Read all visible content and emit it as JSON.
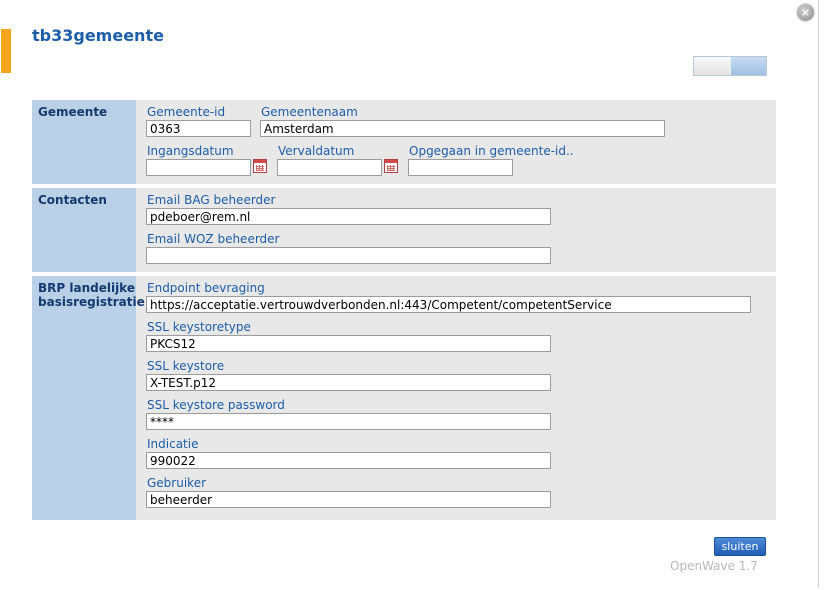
{
  "dialog": {
    "title": "tb33gemeente",
    "close_glyph": "×",
    "footer": "OpenWave 1.7",
    "close_button_label": "sluiten"
  },
  "sections": {
    "gemeente": {
      "heading": "Gemeente",
      "gemeente_id": {
        "label": "Gemeente-id",
        "value": "0363"
      },
      "gemeentenaam": {
        "label": "Gemeentenaam",
        "value": "Amsterdam"
      },
      "ingangsdatum": {
        "label": "Ingangsdatum",
        "value": ""
      },
      "vervaldatum": {
        "label": "Vervaldatum",
        "value": ""
      },
      "opgegaan": {
        "label": "Opgegaan in gemeente-id..",
        "value": ""
      }
    },
    "contacten": {
      "heading": "Contacten",
      "email_bag": {
        "label": "Email BAG beheerder",
        "value": "pdeboer@rem.nl"
      },
      "email_woz": {
        "label": "Email WOZ beheerder",
        "value": ""
      }
    },
    "brp": {
      "heading": "BRP landelijke basisregistratie",
      "endpoint": {
        "label": "Endpoint bevraging",
        "value": "https://acceptatie.vertrouwdverbonden.nl:443/Competent/competentService"
      },
      "keystoretype": {
        "label": "SSL keystoretype",
        "value": "PKCS12"
      },
      "keystore": {
        "label": "SSL keystore",
        "value": "X-TEST.p12"
      },
      "keystore_password": {
        "label": "SSL keystore password",
        "value": "****"
      },
      "indicatie": {
        "label": "Indicatie",
        "value": "990022"
      },
      "gebruiker": {
        "label": "Gebruiker",
        "value": "beheerder"
      }
    }
  },
  "icons": {
    "calendar": "calendar-icon",
    "close": "close-icon"
  },
  "colors": {
    "accent": "#f7a51f",
    "title": "#1d5ea8",
    "section_head_bg": "#b9d0e7",
    "section_bg": "#e8e8e8",
    "button": "#1e5db8"
  }
}
